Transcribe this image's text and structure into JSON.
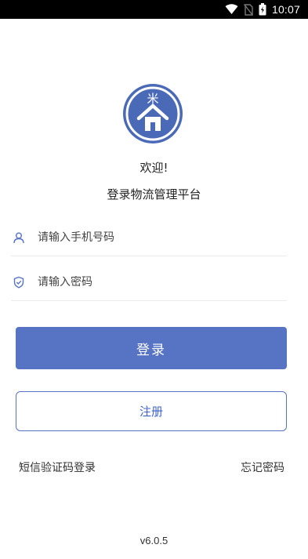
{
  "status_bar": {
    "time": "10:07",
    "icons": [
      "wifi-icon",
      "no-sim-icon",
      "battery-icon"
    ]
  },
  "logo": {
    "icon": "house-with-rice-symbol",
    "glyph": "米",
    "color": "#4a6ab8"
  },
  "welcome": "欢迎!",
  "subtitle": "登录物流管理平台",
  "form": {
    "phone_placeholder": "请输入手机号码",
    "phone_icon": "user-icon",
    "password_placeholder": "请输入密码",
    "password_icon": "shield-icon"
  },
  "buttons": {
    "login": "登录",
    "register": "注册"
  },
  "links": {
    "sms_login": "短信验证码登录",
    "forgot_password": "忘记密码"
  },
  "version": "v6.0.5",
  "colors": {
    "primary": "#5673c4",
    "register_text": "#3e62c8"
  }
}
